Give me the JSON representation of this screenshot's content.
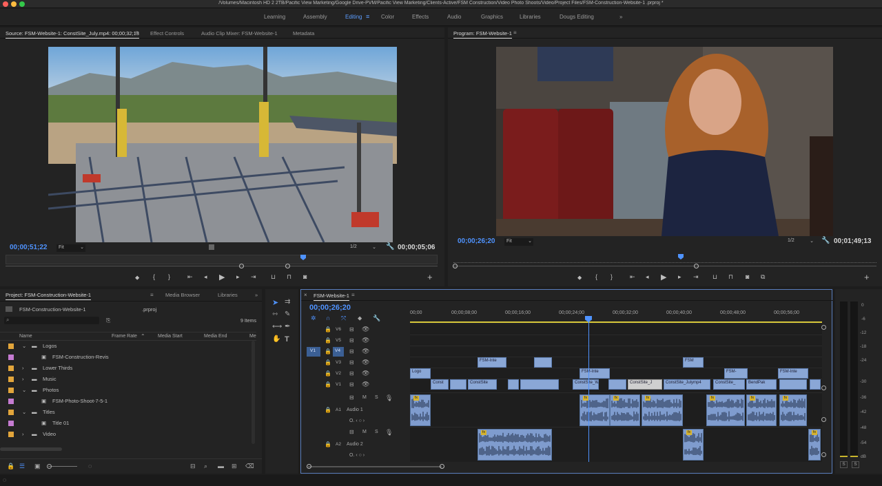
{
  "window": {
    "title": "/Volumes/Macintosh HD 2 2TB/Pacific View Marketing/Google Drive-PVM/Pacific View Marketing/Clients-Active/FSM Construction/Video Photo Shoots/Video/Project Files/FSM-Construction-Website-1                                    .prproj *"
  },
  "workspaces": [
    "Learning",
    "Assembly",
    "Editing",
    "Color",
    "Effects",
    "Audio",
    "Graphics",
    "Libraries",
    "Dougs Editing",
    "»"
  ],
  "source": {
    "tabs": [
      "Source: FSM-Website-1: ConstSite_July.mp4: 00;00;32;13",
      "Effect Controls",
      "Audio Clip Mixer: FSM-Website-1",
      "Metadata"
    ],
    "timecode": "00;00;51;22",
    "fit": "Fit",
    "resolution": "1/2",
    "duration": "00;00;05;06"
  },
  "program": {
    "tab": "Program: FSM-Website-1",
    "timecode": "00;00;26;20",
    "fit": "Fit",
    "resolution": "1/2",
    "duration": "00;01;49;13"
  },
  "project": {
    "tabs": [
      "Project: FSM-Construction-Website-1",
      "Media Browser",
      "Libraries",
      "»"
    ],
    "file": "FSM-Construction-Website-1",
    "ext": ".prproj",
    "items_count": "9 Items",
    "columns": [
      "Name",
      "Frame Rate",
      "Media Start",
      "Media End",
      "Me"
    ],
    "rows": [
      {
        "label": "Logos",
        "color": "#e2a53b",
        "type": "folder-open"
      },
      {
        "label": "FSM-Construction-Revis",
        "color": "#c57bd1",
        "type": "seq"
      },
      {
        "label": "Lower Thirds",
        "color": "#e2a53b",
        "type": "folder"
      },
      {
        "label": "Music",
        "color": "#e2a53b",
        "type": "folder"
      },
      {
        "label": "Photos",
        "color": "#e2a53b",
        "type": "folder-open"
      },
      {
        "label": "FSM-Photo-Shoot-7-5-1",
        "color": "#c57bd1",
        "type": "seq"
      },
      {
        "label": "Titles",
        "color": "#e2a53b",
        "type": "folder-open"
      },
      {
        "label": "Title 01",
        "color": "#c57bd1",
        "type": "seq"
      },
      {
        "label": "Video",
        "color": "#e2a53b",
        "type": "folder"
      }
    ]
  },
  "timeline": {
    "tab": "FSM-Website-1",
    "timecode": "00;00;26;20",
    "ruler": [
      "00;00",
      "00;00;08;00",
      "00;00;16;00",
      "00;00;24;00",
      "00;00;32;00",
      "00;00;40;00",
      "00;00;48;00",
      "00;00;56;00"
    ],
    "video_tracks": [
      "V6",
      "V5",
      "V4",
      "V3",
      "V2",
      "V1"
    ],
    "source_patch": "V1",
    "audio_tracks": [
      {
        "id": "A1",
        "name": "Audio 1"
      },
      {
        "id": "A2",
        "name": "Audio 2"
      }
    ],
    "track_buttons": {
      "mute": "M",
      "solo": "S"
    },
    "clip_labels": {
      "v3a": "FSM-Inte",
      "v3c": "FSM",
      "v2a": "Logo",
      "v2b": "FSM-Inte",
      "v2c": "FSM-",
      "v2d": "FSM-Inte",
      "v1a": "Const",
      "v1b": "ConstSite",
      "v1c": "ConstSite_Wa",
      "v1d": "ConstSite_J",
      "v1e": "ConstSite_Julymp4",
      "v1f": "ConstSite_",
      "v1g": "BendPak",
      "fx": "fx"
    }
  },
  "meter": {
    "scale": [
      "0",
      "-6",
      "-12",
      "-18",
      "-24",
      "-30",
      "-36",
      "-42",
      "-48",
      "-54",
      "dB"
    ],
    "solo": "S"
  },
  "colors": {
    "accent": "#4f93ff",
    "clip_video": "#8aa7d6",
    "clip_audio": "#7f9cce",
    "playhead": "#4f93ff",
    "work_area": "#d9c93a"
  }
}
